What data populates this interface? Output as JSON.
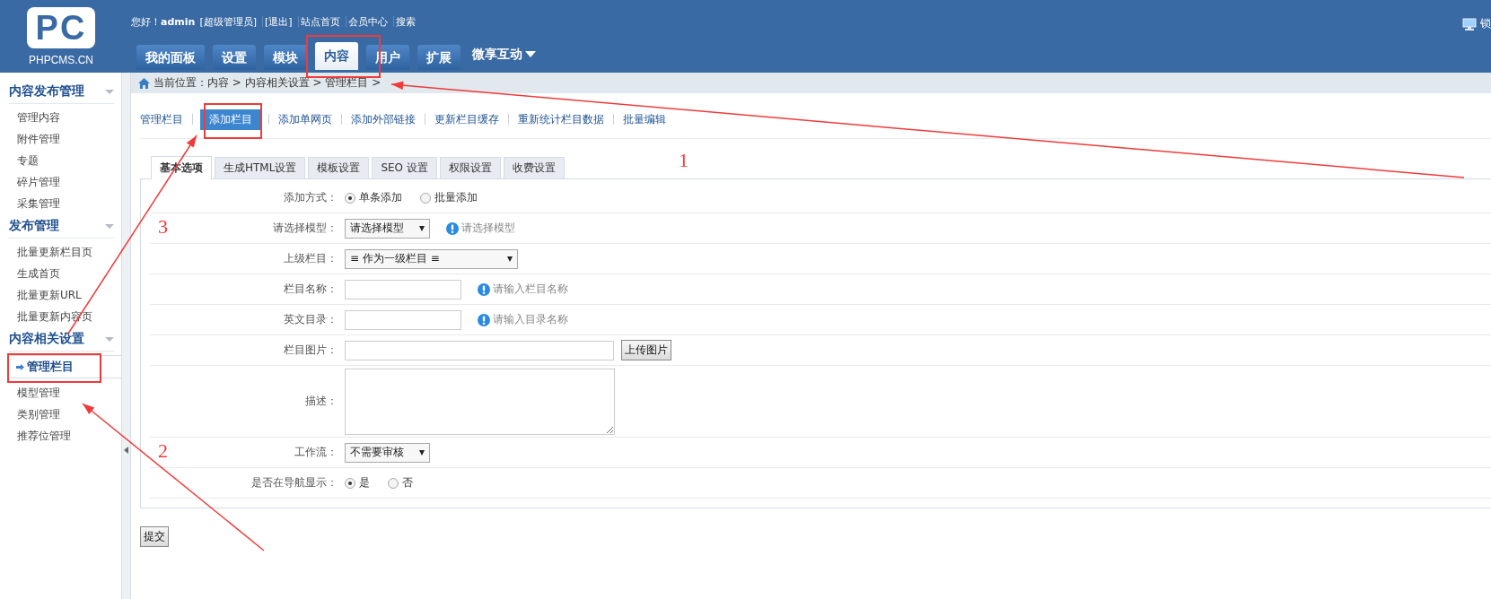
{
  "header": {
    "logo_mark": "PC",
    "logo_text": "PHPCMS.CN",
    "greeting": "您好！",
    "user": "admin",
    "role": "[超级管理员]",
    "links": [
      "[退出]",
      "站点首页",
      "会员中心",
      "搜索"
    ],
    "lock_label": "锁"
  },
  "nav_tabs": [
    {
      "label": "我的面板",
      "selected": false,
      "kind": "tab"
    },
    {
      "label": "设置",
      "selected": false,
      "kind": "tab"
    },
    {
      "label": "模块",
      "selected": false,
      "kind": "tab"
    },
    {
      "label": "内容",
      "selected": true,
      "kind": "tab"
    },
    {
      "label": "用户",
      "selected": false,
      "kind": "tab"
    },
    {
      "label": "扩展",
      "selected": false,
      "kind": "tab"
    },
    {
      "label": "微享互动",
      "selected": false,
      "kind": "menu"
    }
  ],
  "breadcrumb": "当前位置：内容 > 内容相关设置 > 管理栏目 >",
  "sidebar": {
    "sections": [
      {
        "title": "内容发布管理",
        "expanded": true,
        "items": [
          {
            "label": "管理内容",
            "selected": false
          },
          {
            "label": "附件管理",
            "selected": false
          },
          {
            "label": "专题",
            "selected": false
          },
          {
            "label": "碎片管理",
            "selected": false
          },
          {
            "label": "采集管理",
            "selected": false
          }
        ]
      },
      {
        "title": "发布管理",
        "expanded": true,
        "items": [
          {
            "label": "批量更新栏目页",
            "selected": false
          },
          {
            "label": "生成首页",
            "selected": false
          },
          {
            "label": "批量更新URL",
            "selected": false
          },
          {
            "label": "批量更新内容页",
            "selected": false
          }
        ]
      },
      {
        "title": "内容相关设置",
        "expanded": true,
        "items": [
          {
            "label": "管理栏目",
            "selected": true
          },
          {
            "label": "模型管理",
            "selected": false
          },
          {
            "label": "类别管理",
            "selected": false
          },
          {
            "label": "推荐位管理",
            "selected": false
          }
        ]
      }
    ]
  },
  "subnav": [
    {
      "label": "管理栏目",
      "selected": false
    },
    {
      "label": "添加栏目",
      "selected": true
    },
    {
      "label": "添加单网页",
      "selected": false
    },
    {
      "label": "添加外部链接",
      "selected": false
    },
    {
      "label": "更新栏目缓存",
      "selected": false
    },
    {
      "label": "重新统计栏目数据",
      "selected": false
    },
    {
      "label": "批量编辑",
      "selected": false
    }
  ],
  "form_tabs": [
    {
      "label": "基本选项",
      "selected": true
    },
    {
      "label": "生成HTML设置",
      "selected": false
    },
    {
      "label": "模板设置",
      "selected": false
    },
    {
      "label": "SEO 设置",
      "selected": false
    },
    {
      "label": "权限设置",
      "selected": false
    },
    {
      "label": "收费设置",
      "selected": false
    }
  ],
  "form_rows": [
    {
      "kind": "radio",
      "label": "添加方式：",
      "options": [
        {
          "label": "单条添加",
          "selected": true
        },
        {
          "label": "批量添加",
          "selected": false
        }
      ]
    },
    {
      "kind": "select",
      "label": "请选择模型：",
      "value": "请选择模型",
      "hint": "请选择模型"
    },
    {
      "kind": "longselect",
      "label": "上级栏目：",
      "value": "≡ 作为一级栏目 ≡"
    },
    {
      "kind": "text",
      "label": "栏目名称：",
      "hint": "请输入栏目名称"
    },
    {
      "kind": "text",
      "label": "英文目录：",
      "hint": "请输入目录名称"
    },
    {
      "kind": "file",
      "label": "栏目图片：",
      "button": "上传图片"
    },
    {
      "kind": "textarea",
      "label": "描述："
    },
    {
      "kind": "select",
      "label": "工作流：",
      "value": "不需要审核"
    },
    {
      "kind": "radio",
      "label": "是否在导航显示：",
      "options": [
        {
          "label": "是",
          "selected": true
        },
        {
          "label": "否",
          "selected": false
        }
      ]
    }
  ],
  "submit": "提交",
  "annotations": {
    "labels": [
      "1",
      "2",
      "3"
    ]
  }
}
